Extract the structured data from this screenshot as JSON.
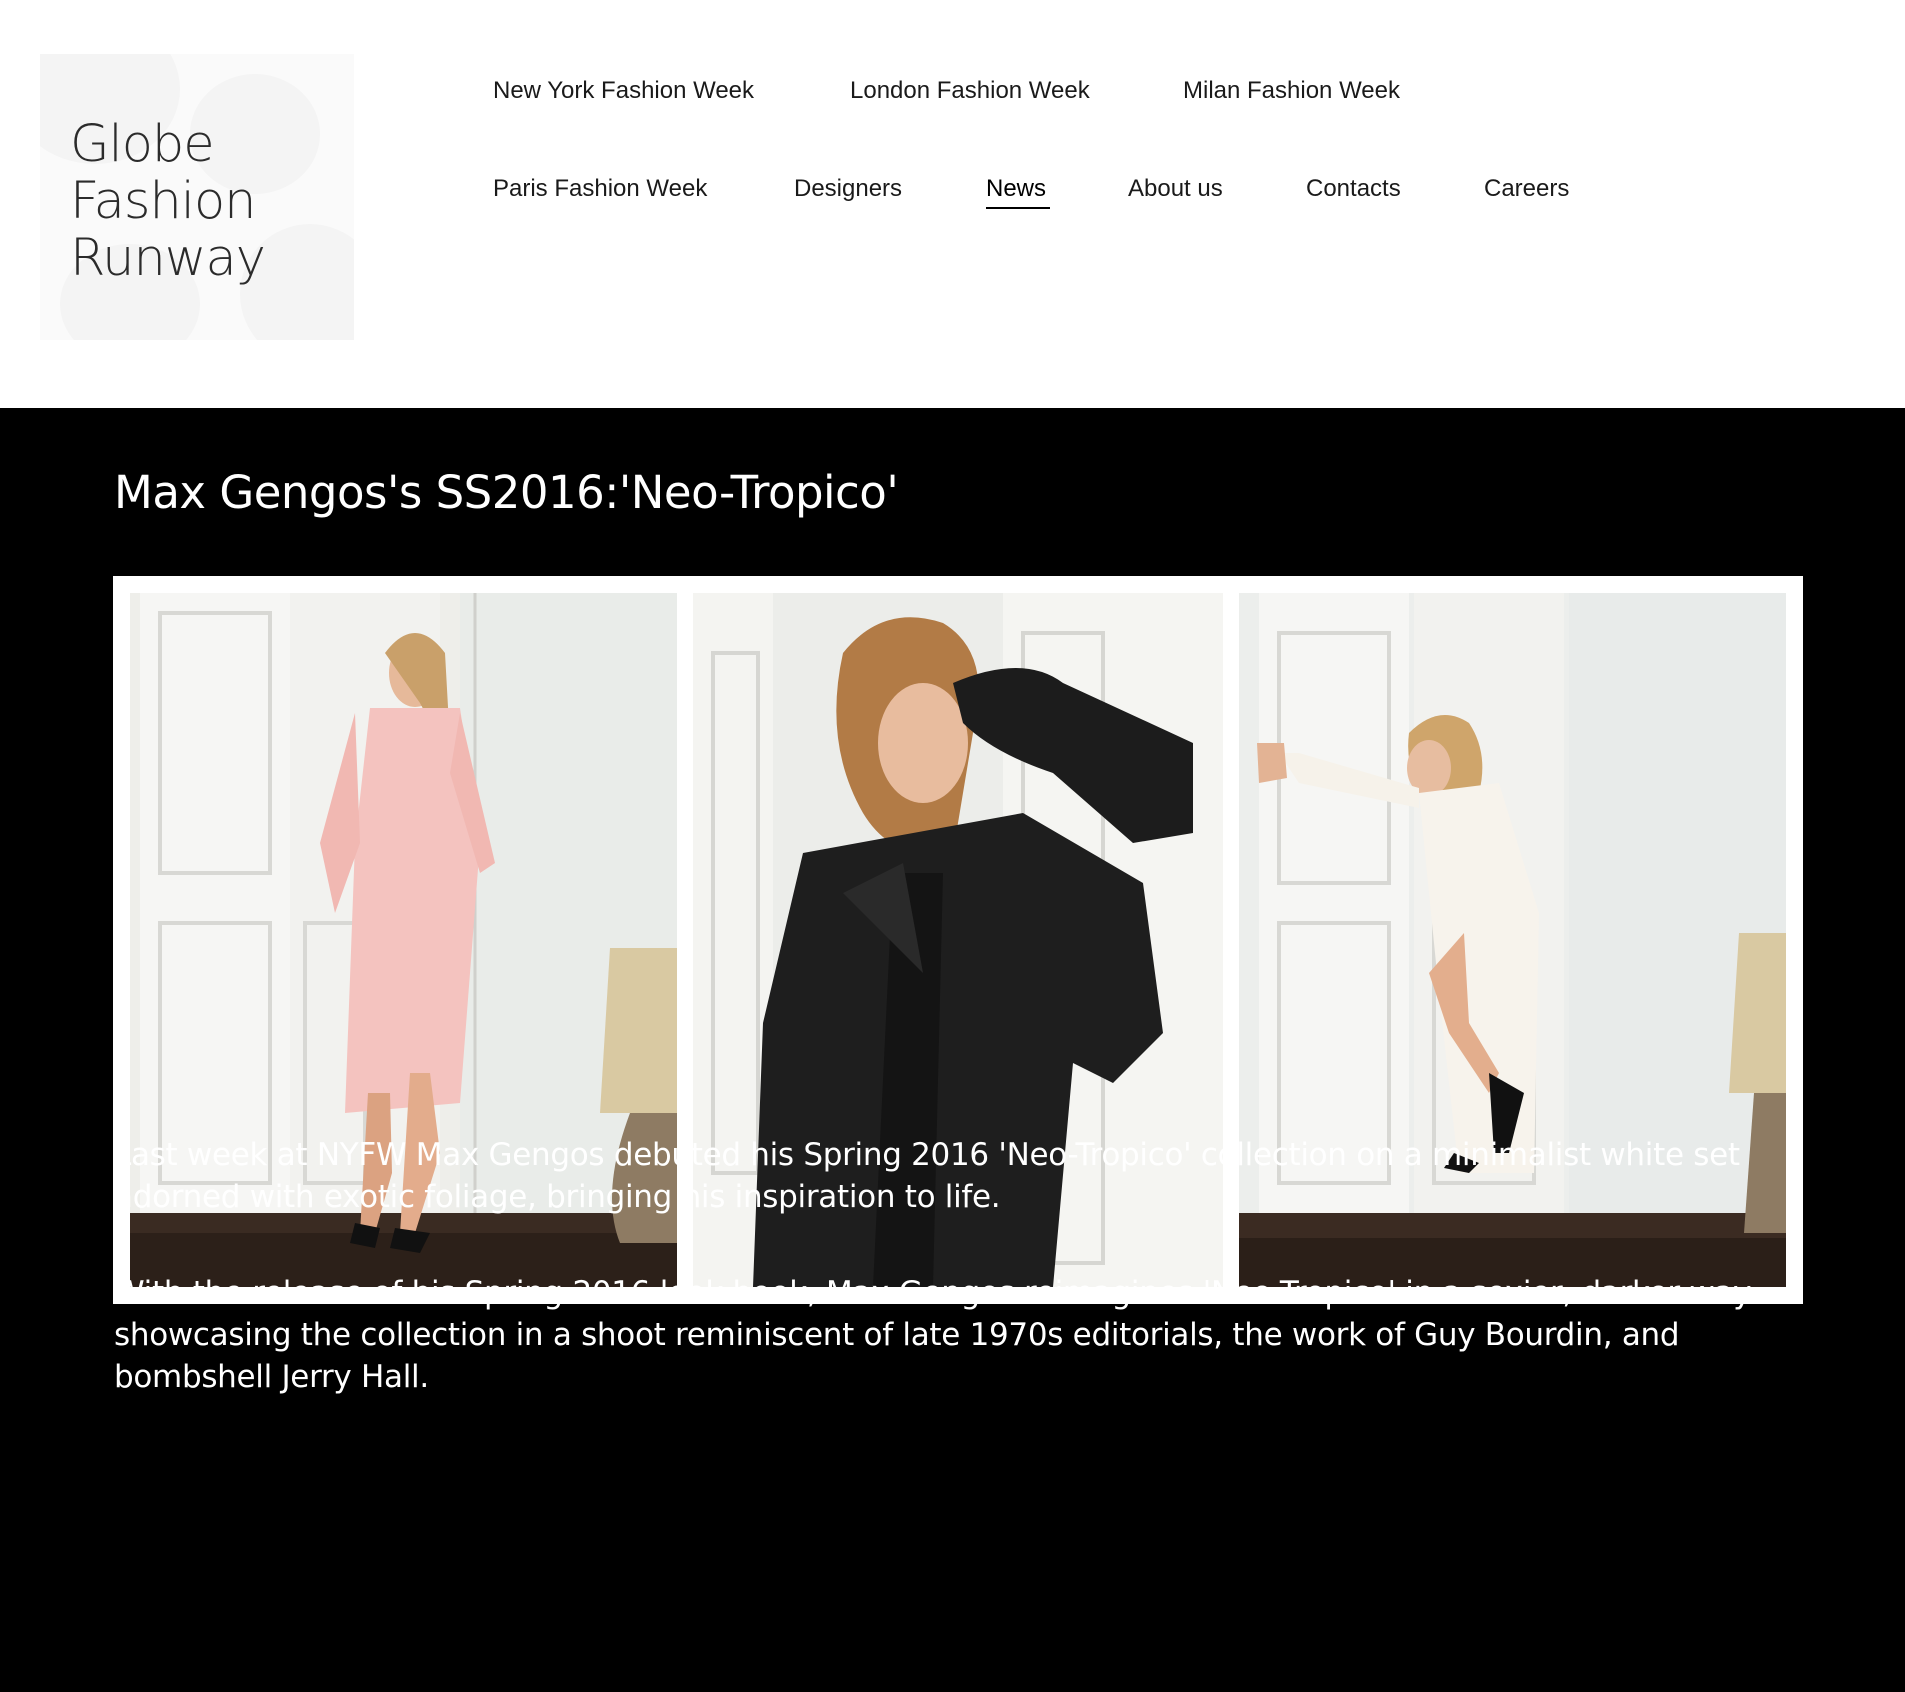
{
  "logo": {
    "line1": "Globe",
    "line2": "Fashion",
    "line3": "Runway"
  },
  "nav": {
    "row1": [
      "New York Fashion Week",
      "London Fashion Week",
      "Milan Fashion Week"
    ],
    "row2": [
      "Paris Fashion Week",
      "Designers",
      "News",
      "About us",
      "Contacts",
      "Careers"
    ],
    "active": "News"
  },
  "article": {
    "title": "Max Gengos's SS2016:'Neo-Tropico'",
    "photos": [
      {
        "outfit": "pink sheer shirt and skirt"
      },
      {
        "outfit": "black textured moto jacket"
      },
      {
        "outfit": "white draped gown"
      }
    ],
    "paragraphs": [
      "Last week at NYFW Max Gengos debuted his Spring 2016 'Neo-Tropico' collection on a minimalist white set adorned with exotic foliage, bringing his inspiration to life.",
      "With the release of his Spring 2016 look book, Max Gengos reimagines 'Neo-Tropico' in a sexier, darker way: showcasing the collection in a shoot reminiscent of late 1970s editorials, the work of Guy Bourdin, and bombshell Jerry Hall."
    ]
  },
  "colors": {
    "header_bg": "#ffffff",
    "article_bg": "#000000",
    "text_dark": "#1a1a1a",
    "text_light": "#ffffff"
  }
}
